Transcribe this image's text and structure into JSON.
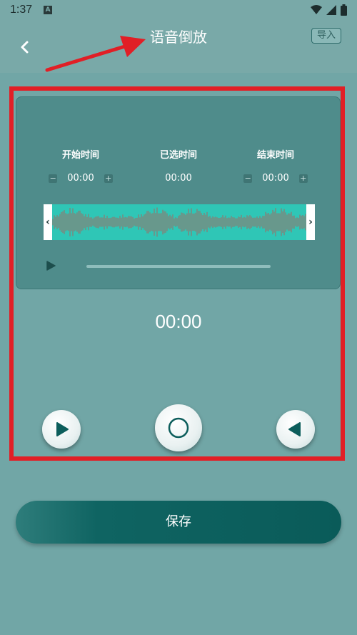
{
  "status_bar": {
    "time": "1:37",
    "notification_badge": "A",
    "icons": [
      "wifi-icon",
      "signal-icon",
      "battery-icon"
    ]
  },
  "header": {
    "title": "语音倒放",
    "import_label": "导入",
    "back_icon": "chevron-left-icon"
  },
  "editor": {
    "start": {
      "label": "开始时间",
      "value": "00:00",
      "minus": "−",
      "plus": "+"
    },
    "selected": {
      "label": "已选时间",
      "value": "00:00"
    },
    "end": {
      "label": "结束时间",
      "value": "00:00",
      "minus": "−",
      "plus": "+"
    },
    "handle_left": "‹",
    "handle_right": "›"
  },
  "playback_time": "00:00",
  "controls": {
    "play_icon": "play-icon",
    "record_icon": "record-icon",
    "reverse_play_icon": "reverse-play-icon"
  },
  "save_label": "保存",
  "colors": {
    "background": "#79a9a8",
    "card": "#4f8c8b",
    "waveform_fill": "#2fc6b6",
    "waveform_lines": "#a16a62",
    "save_button": "#0a5b59",
    "annotation": "#e11f26"
  }
}
